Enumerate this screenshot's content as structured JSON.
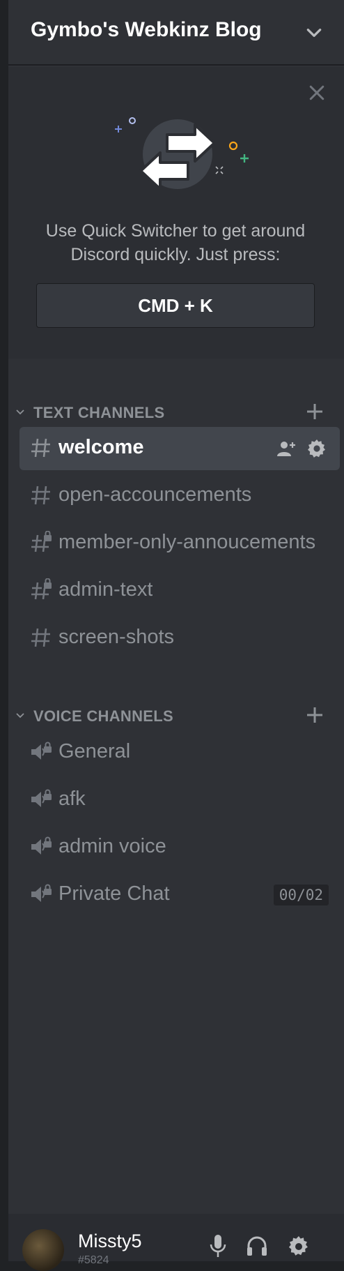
{
  "server": {
    "name": "Gymbo's Webkinz Blog"
  },
  "quick_switcher": {
    "message": "Use Quick Switcher to get around Discord quickly. Just press:",
    "shortcut": "CMD + K"
  },
  "text_channels": {
    "label": "TEXT CHANNELS",
    "items": [
      {
        "name": "welcome",
        "locked": false,
        "active": true
      },
      {
        "name": "open-accouncements",
        "locked": false,
        "active": false
      },
      {
        "name": "member-only-annoucements",
        "locked": true,
        "active": false
      },
      {
        "name": "admin-text",
        "locked": true,
        "active": false
      },
      {
        "name": "screen-shots",
        "locked": false,
        "active": false
      }
    ]
  },
  "voice_channels": {
    "label": "VOICE CHANNELS",
    "items": [
      {
        "name": "General",
        "locked": true
      },
      {
        "name": "afk",
        "locked": true
      },
      {
        "name": "admin voice",
        "locked": true
      },
      {
        "name": "Private Chat",
        "locked": true,
        "user_limit": "00/02"
      }
    ]
  },
  "user": {
    "username": "Missty5",
    "discriminator": "#5824"
  },
  "colors": {
    "sidebar_bg": "#2f3136",
    "active_channel_bg": "#42464d",
    "muted_text": "#8e9297",
    "accent_green": "#43b581",
    "accent_yellow": "#faa61a",
    "accent_blue": "#7289da"
  }
}
